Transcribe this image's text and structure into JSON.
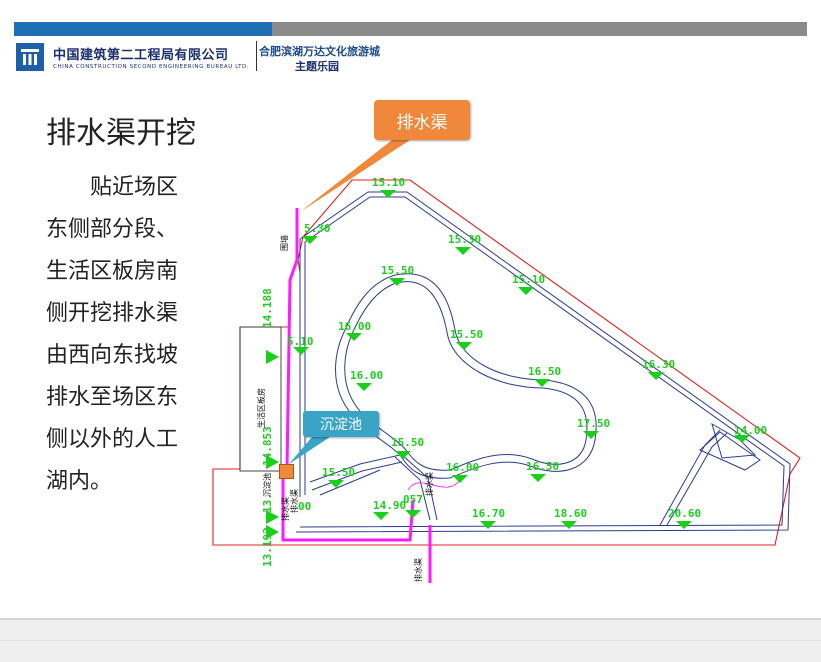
{
  "header": {
    "company_cn": "中国建筑第二工程局有限公司",
    "company_en": "CHINA CONSTRUCTION SECOND ENGINEERING BUREAU LTD.",
    "project_line1": "合肥滨湖万达文化旅游城",
    "project_line2": "主题乐园",
    "colors": {
      "blue_bar": "#1f6fb4",
      "gray_bar": "#8a8a8a",
      "brand": "#1b2f6d"
    }
  },
  "slide": {
    "title": "排水渠开挖",
    "body_lines": [
      "贴近场区",
      "东侧部分段、",
      "生活区板房南",
      "侧开挖排水渠",
      "由西向东找坡",
      "排水至场区东",
      "侧以外的人工",
      "湖内。"
    ]
  },
  "map": {
    "callout_main": "排水渠",
    "callout_sedimentation": "沉淀池",
    "labels": {
      "living_area": "生活区板房",
      "drain_channel": "排水渠",
      "fence": "围墙",
      "sedimentation_tank": "沉淀池",
      "drain_channel_2": "排水渠",
      "drain_channel_3": "排水渠",
      "drain_channel_east": "排水渠"
    },
    "elevations": [
      "15.10",
      "5.30",
      "15.30",
      "15.50",
      "15.10",
      "16.00",
      "15.50",
      "5.10",
      "16.00",
      "16.50",
      "16.30",
      "17.50",
      "14.00",
      "15.50",
      "16.00",
      "16.50",
      "15.50",
      "14.90",
      "057",
      "16.70",
      "18.60",
      "20.60",
      "00"
    ],
    "elevations_vertical": [
      "14.188",
      "14.853",
      "13.",
      "13.192"
    ],
    "colors": {
      "road": "#2c3b8f",
      "boundary": "#e02020",
      "drain": "#ff1aff",
      "elev_text": "#22cc22",
      "tri": "#18d018"
    }
  }
}
